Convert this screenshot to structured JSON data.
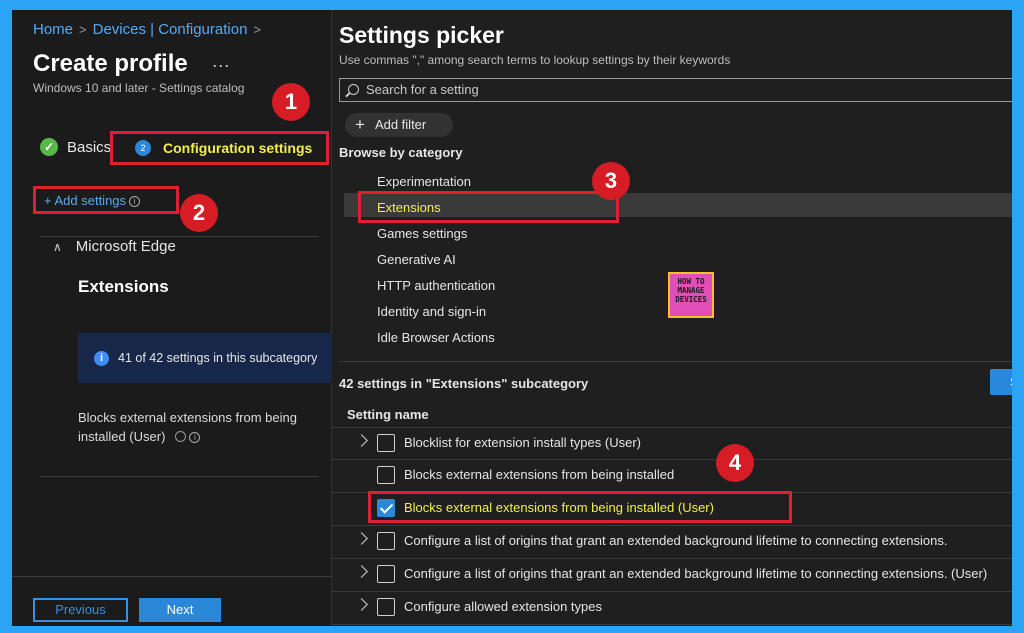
{
  "breadcrumb": [
    "Home",
    "Devices | Configuration"
  ],
  "page": {
    "title": "Create profile",
    "more_label": "···",
    "subtitle": "Windows 10 and later - Settings catalog"
  },
  "wizard": {
    "step1_label": "Basics",
    "step2_number": "2",
    "step2_label": "Configuration settings"
  },
  "left": {
    "add_settings": "+ Add settings",
    "group_label": "Microsoft Edge",
    "subcategory_title": "Extensions",
    "info_text": "41 of 42 settings in this subcategory",
    "setting_text": "Blocks external extensions from being installed (User)"
  },
  "footer": {
    "previous": "Previous",
    "next": "Next"
  },
  "picker": {
    "title": "Settings picker",
    "hint": "Use commas \",\" among search terms to lookup settings by their keywords",
    "search_placeholder": "Search for a setting",
    "add_filter": "Add filter",
    "browse_heading": "Browse by category",
    "categories": [
      "Experimentation",
      "Extensions",
      "Games settings",
      "Generative AI",
      "HTTP authentication",
      "Identity and sign-in",
      "Idle Browser Actions"
    ],
    "selected_category": "Extensions",
    "count_text": "42 settings in \"Extensions\" subcategory",
    "select_button": "Se",
    "column_header": "Setting name",
    "settings": [
      {
        "label": "Blocklist for extension install types (User)",
        "checked": false,
        "expandable": true
      },
      {
        "label": "Blocks external extensions from being installed",
        "checked": false,
        "expandable": false
      },
      {
        "label": "Blocks external extensions from being installed (User)",
        "checked": true,
        "expandable": false
      },
      {
        "label": "Configure a list of origins that grant an extended background lifetime to connecting extensions.",
        "checked": false,
        "expandable": true
      },
      {
        "label": "Configure a list of origins that grant an extended background lifetime to connecting extensions. (User)",
        "checked": false,
        "expandable": true
      },
      {
        "label": "Configure allowed extension types",
        "checked": false,
        "expandable": true
      }
    ]
  },
  "logo": {
    "line1": "HOW TO",
    "line2": "MANAGE",
    "line3": "DEVICES"
  },
  "annotations": [
    "1",
    "2",
    "3",
    "4"
  ],
  "colors": {
    "highlight_box": "#e0202e",
    "highlight_text": "#f2f04a",
    "accent": "#2b88d8",
    "badge": "#d61d25"
  }
}
